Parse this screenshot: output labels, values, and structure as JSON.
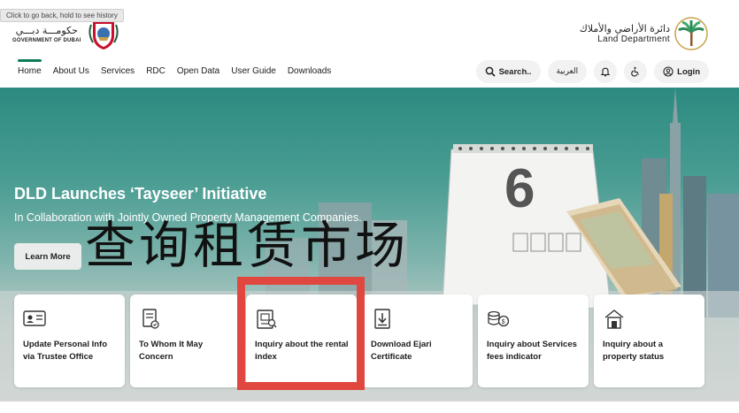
{
  "browser": {
    "tooltip": "Click to go back, hold to see history"
  },
  "header": {
    "gov_logo_ar": "حكومـــة دبـــي",
    "gov_logo_en": "GOVERNMENT OF DUBAI",
    "dld_logo_ar": "دائرة الأراضي والأملاك",
    "dld_logo_en": "Land Department"
  },
  "nav": {
    "items": [
      {
        "label": "Home",
        "active": true
      },
      {
        "label": "About Us"
      },
      {
        "label": "Services"
      },
      {
        "label": "RDC"
      },
      {
        "label": "Open Data"
      },
      {
        "label": "User Guide"
      },
      {
        "label": "Downloads"
      }
    ],
    "search_label": "Search..",
    "arabic_label": "العربية",
    "login_label": "Login"
  },
  "hero": {
    "title": "DLD Launches ‘Tayseer’ Initiative",
    "subtitle": "In Collaboration with Jointly Owned Property Management Companies.",
    "learn_more_label": "Learn More",
    "calendar_number": "6"
  },
  "overlay": {
    "chinese_text": "查询租赁市场"
  },
  "quick_services": [
    {
      "label": "Update Personal Info via Trustee Office",
      "icon": "id-card-icon"
    },
    {
      "label": "To Whom It May Concern",
      "icon": "certificate-icon"
    },
    {
      "label": "Inquiry about the rental index",
      "icon": "rental-index-icon",
      "highlighted": true
    },
    {
      "label": "Download Ejari Certificate",
      "icon": "download-doc-icon"
    },
    {
      "label": "Inquiry about Services fees indicator",
      "icon": "coins-icon"
    },
    {
      "label": "Inquiry about a property status",
      "icon": "property-status-icon"
    }
  ],
  "colors": {
    "brand_green": "#0f7a5a",
    "highlight_red": "#e0473e",
    "hero_teal": "#2c8a80"
  }
}
